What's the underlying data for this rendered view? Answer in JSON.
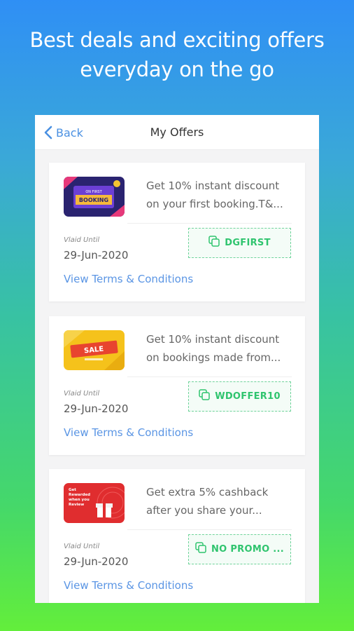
{
  "hero": {
    "line1": "Best deals and exciting offers",
    "line2": "everyday on the go"
  },
  "header": {
    "back_label": "Back",
    "title": "My Offers"
  },
  "offers": [
    {
      "desc_line1": "Get 10% instant discount",
      "desc_line2": "on your first booking.T&...",
      "valid_label": "Vlaid Until",
      "valid_date": "29-Jun-2020",
      "code": "DGFIRST",
      "terms": "View Terms & Conditions",
      "thumb_text1": "ON FIRST",
      "thumb_text2": "BOOKING"
    },
    {
      "desc_line1": "Get 10% instant discount",
      "desc_line2": "on bookings made from...",
      "valid_label": "Vlaid Until",
      "valid_date": "29-Jun-2020",
      "code": "WDOFFER10",
      "terms": "View Terms & Conditions",
      "thumb_text1": "SALE"
    },
    {
      "desc_line1": "Get extra 5% cashback",
      "desc_line2": "after you share your...",
      "valid_label": "Vlaid Until",
      "valid_date": "29-Jun-2020",
      "code": "NO PROMO ...",
      "terms": "View Terms & Conditions",
      "thumb_text1": "Get",
      "thumb_text2": "Rewarded",
      "thumb_text3": "when you",
      "thumb_text4": "Review"
    }
  ],
  "colors": {
    "accent_link": "#5a95e4",
    "code_green": "#2fc46e"
  }
}
